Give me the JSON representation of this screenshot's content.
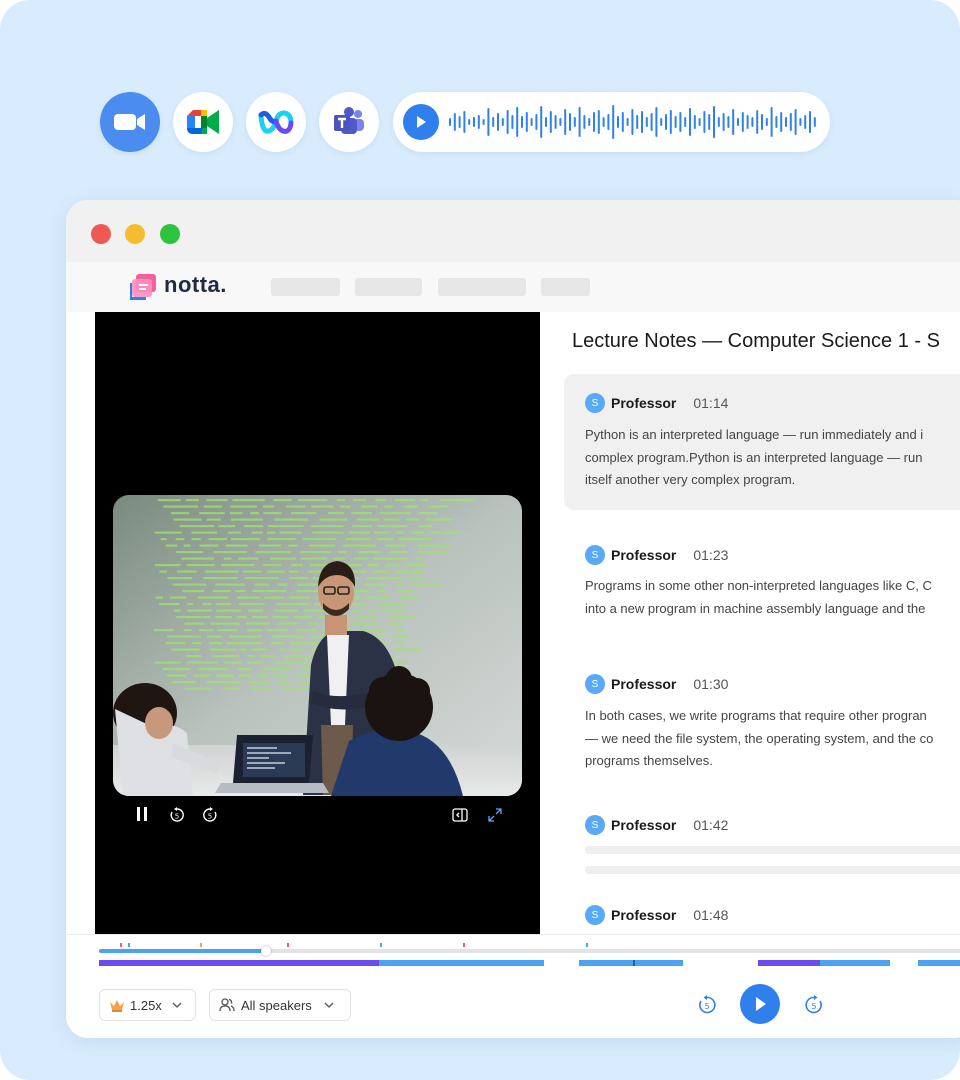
{
  "integrations": [
    {
      "name": "Zoom",
      "icon": "zoom-camera-icon"
    },
    {
      "name": "Google Meet",
      "icon": "google-meet-icon"
    },
    {
      "name": "Webex",
      "icon": "webex-icon"
    },
    {
      "name": "Microsoft Teams",
      "icon": "teams-icon"
    }
  ],
  "audio_preview": {
    "icon": "play-icon"
  },
  "window": {
    "traffic_lights": [
      "#ee5a52",
      "#f6bc2f",
      "#2cc33d"
    ]
  },
  "app": {
    "logo_text": "notta."
  },
  "transcript": {
    "title": "Lecture Notes — Computer Science 1 - S",
    "segments": [
      {
        "avatar": "S",
        "speaker": "Professor",
        "time": "01:14",
        "lines": [
          "Python is an interpreted language — run immediately and i",
          "complex program.Python is an interpreted language — run",
          "itself another very complex program."
        ]
      },
      {
        "avatar": "S",
        "speaker": "Professor",
        "time": "01:23",
        "lines": [
          "Programs in some other non-interpreted languages like C, C",
          "into a new program in machine assembly language and the"
        ]
      },
      {
        "avatar": "S",
        "speaker": "Professor",
        "time": "01:30",
        "lines": [
          "In both cases, we write programs that require other progran",
          "— we need the file system, the operating system, and the co",
          "programs themselves."
        ]
      },
      {
        "avatar": "S",
        "speaker": "Professor",
        "time": "01:42",
        "lines": []
      },
      {
        "avatar": "S",
        "speaker": "Professor",
        "time": "01:48",
        "lines": []
      }
    ]
  },
  "player": {
    "progress": 0.19,
    "speed": "1.25x",
    "speaker_filter": "All speakers",
    "colors": {
      "accent": "#2f80ed",
      "speaker_a": "#6c4bf0",
      "speaker_b": "#4aa3f0"
    }
  }
}
